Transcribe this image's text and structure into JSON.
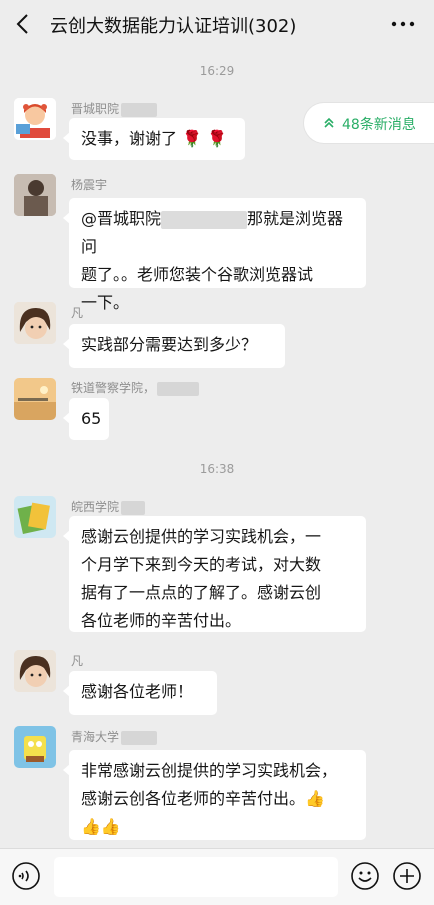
{
  "header": {
    "title": "云创大数据能力认证培训(302)"
  },
  "new_messages": {
    "label": "48条新消息"
  },
  "timestamps": [
    "16:29",
    "16:38"
  ],
  "messages": [
    {
      "sender": "晋城职院",
      "text": "没事，谢谢了"
    },
    {
      "sender": "杨震宇",
      "text_parts": [
        "@晋城职院",
        "那就是浏览器问",
        "题了。。老师您装个谷歌浏览器试",
        "一下。"
      ]
    },
    {
      "sender": "凡",
      "text": "实践部分需要达到多少？"
    },
    {
      "sender": "铁道警察学院，",
      "text": "65"
    },
    {
      "sender": "皖西学院",
      "lines": [
        "感谢云创提供的学习实践机会，一",
        "个月学下来到今天的考试，对大数",
        "据有了一点点的了解了。感谢云创",
        "各位老师的辛苦付出。"
      ]
    },
    {
      "sender": "凡",
      "text": "感谢各位老师！"
    },
    {
      "sender": "青海大学",
      "lines": [
        "非常感谢云创提供的学习实践机会，",
        "感谢云创各位老师的辛苦付出。"
      ]
    }
  ],
  "icons": {
    "back": "back-arrow-icon",
    "more": "more-dots-icon",
    "voice": "voice-icon",
    "emoji": "emoji-icon",
    "plus": "plus-icon",
    "thumbs": "thumbs-up-icon",
    "rose": "rose-icon"
  },
  "colors": {
    "background": "#ededed",
    "accent_green": "#2aae67",
    "bubble": "#ffffff"
  }
}
